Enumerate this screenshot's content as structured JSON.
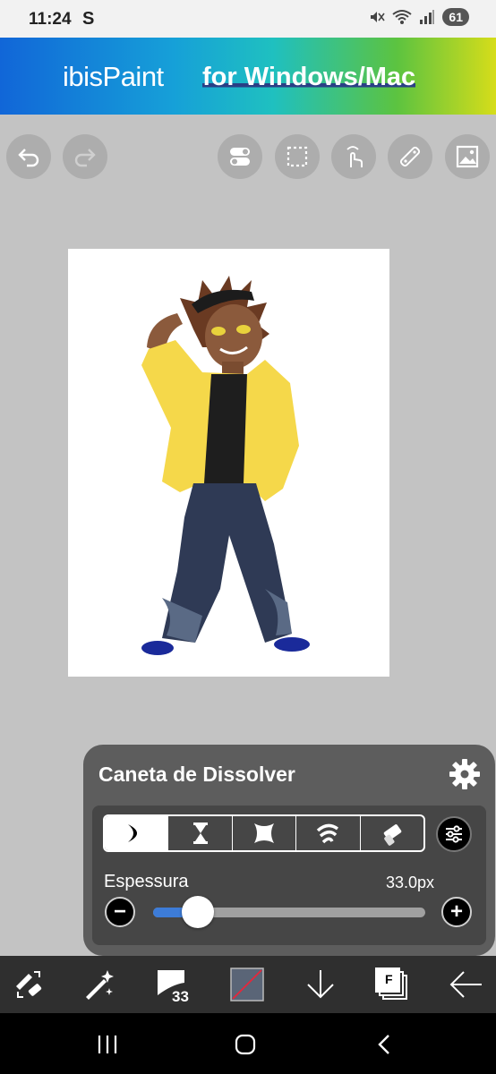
{
  "status_bar": {
    "time": "11:24",
    "s_glyph": "S",
    "battery": "61"
  },
  "banner": {
    "logo": "ibisPaint",
    "tagline": "for Windows/Mac"
  },
  "toolbar": {
    "left": [
      {
        "icon": "undo-icon"
      },
      {
        "icon": "redo-icon"
      }
    ],
    "right": [
      {
        "icon": "toggle-icon"
      },
      {
        "icon": "selection-icon"
      },
      {
        "icon": "hand-touch-icon"
      },
      {
        "icon": "ruler-icon"
      },
      {
        "icon": "gallery-icon"
      }
    ]
  },
  "brush_panel": {
    "title": "Caneta de Dissolver",
    "segments": [
      {
        "icon": "brush-stroke-icon",
        "active": true
      },
      {
        "icon": "hourglass-icon",
        "active": false
      },
      {
        "icon": "blur-icon",
        "active": false
      },
      {
        "icon": "smudge-icon",
        "active": false
      },
      {
        "icon": "eraser-icon",
        "active": false
      }
    ],
    "thickness_label": "Espessura",
    "thickness_value": "33.0px",
    "minus": "−",
    "plus": "+",
    "slider_fraction": 0.13
  },
  "bottom_toolbar": {
    "brush_size": "33",
    "layer_label": "F",
    "accent_color": "#3d7cd8"
  }
}
